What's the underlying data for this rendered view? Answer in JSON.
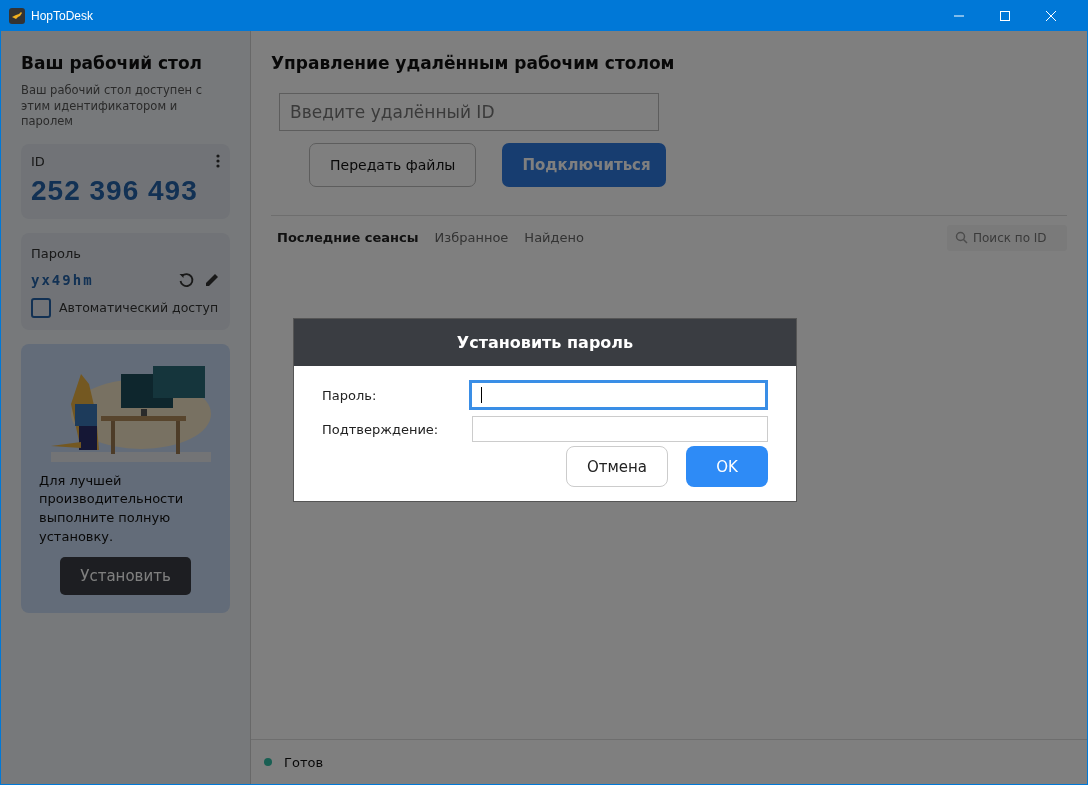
{
  "window": {
    "title": "HopToDesk"
  },
  "sidebar": {
    "title": "Ваш рабочий стол",
    "description": "Ваш рабочий стол доступен с этим идентификатором и паролем",
    "id_card": {
      "label": "ID",
      "value": "252 396 493"
    },
    "password_card": {
      "label": "Пароль",
      "value": "yx49hm",
      "auto_access": {
        "label": "Автоматический доступ",
        "checked": false
      }
    },
    "promo": {
      "kind": "picture",
      "text": "Для лучшей производительности выполните полную установку.",
      "button": "Установить"
    }
  },
  "main": {
    "title": "Управление удалённым рабочим столом",
    "remote_id_field": {
      "placeholder": "Введите удалённый ID"
    },
    "buttons": [
      {
        "label": "Передать файлы",
        "kind": "secondary"
      },
      {
        "label": "Подключиться",
        "kind": "primary"
      }
    ],
    "tabs": [
      {
        "label": "Последние сеансы",
        "selected": true
      },
      {
        "label": "Избранное",
        "selected": false
      },
      {
        "label": "Найдено",
        "selected": false
      }
    ],
    "search": {
      "placeholder": "Поиск по ID"
    }
  },
  "status_bar": {
    "text": "Готов"
  },
  "dialog": {
    "title": "Установить пароль",
    "fields": [
      {
        "label": "Пароль:",
        "focused": true
      },
      {
        "label": "Подтверждение:",
        "focused": false
      }
    ],
    "buttons": [
      {
        "label": "Отмена",
        "kind": "secondary"
      },
      {
        "label": "OK",
        "kind": "primary"
      }
    ]
  }
}
